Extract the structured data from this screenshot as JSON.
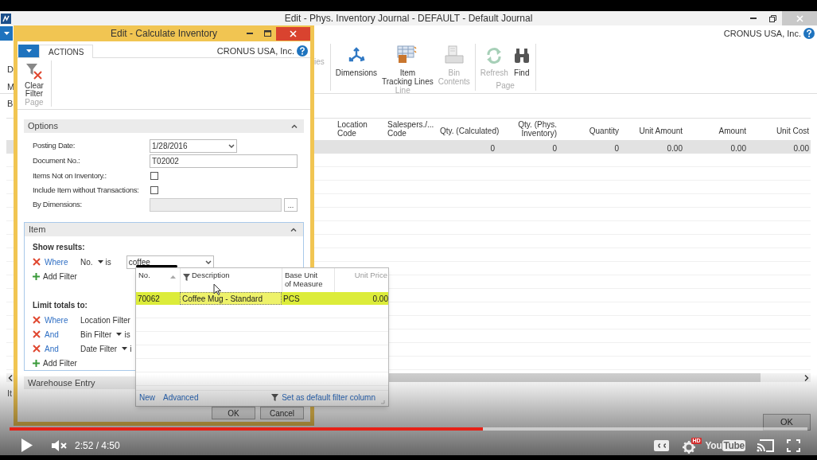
{
  "main_window": {
    "title": "Edit - Phys. Inventory Journal - DEFAULT - Default Journal",
    "company": "CRONUS USA, Inc.",
    "ribbon_fragments": [
      "D",
      "M"
    ],
    "ribbon_fragment_right": "ies",
    "ribbon_groups": [
      {
        "label": "Line",
        "actions": [
          {
            "label": "Dimensions",
            "disabled": false
          },
          {
            "label": "Item Tracking Lines",
            "disabled": false
          },
          {
            "label": "Bin Contents",
            "disabled": true
          }
        ]
      },
      {
        "label": "Page",
        "actions": [
          {
            "label": "Refresh",
            "disabled": true
          },
          {
            "label": "Find",
            "disabled": false
          }
        ]
      }
    ],
    "section_fragment": "B",
    "grid": {
      "columns": [
        "Location Code",
        "Salespers./... Code",
        "Qty. (Calculated)",
        "Qty. (Phys. Inventory)",
        "Quantity",
        "Unit Amount",
        "Amount",
        "Unit Cost"
      ],
      "rows": [
        {
          "selected": true,
          "cells": [
            "",
            "",
            "0",
            "0",
            "0",
            "0.00",
            "0.00",
            "0.00"
          ]
        }
      ]
    },
    "footer_fragment": "It",
    "buttons": [
      "OK"
    ]
  },
  "dialog": {
    "title": "Edit - Calculate Inventory",
    "tabs": [
      {
        "label": "ACTIONS",
        "selected": true
      }
    ],
    "company": "CRONUS USA, Inc.",
    "actions": [
      {
        "label": "Clear Filter"
      }
    ],
    "action_group": "Page",
    "options": {
      "title": "Options",
      "expanded": true,
      "fields": [
        {
          "label": "Posting Date:",
          "kind": "dropdown",
          "value": "1/28/2016"
        },
        {
          "label": "Document No.:",
          "kind": "text",
          "value": "T02002"
        },
        {
          "label": "Items Not on Inventory.:",
          "kind": "checkbox",
          "checked": false
        },
        {
          "label": "Include Item without Transactions:",
          "kind": "checkbox",
          "checked": false
        },
        {
          "label": "By Dimensions:",
          "kind": "lookup",
          "disabled": true,
          "button": "..."
        }
      ]
    },
    "item": {
      "title": "Item",
      "expanded": true,
      "show_results": {
        "heading": "Show results:",
        "filters": [
          {
            "conjunction": "Where",
            "field": "No.",
            "operator": "is",
            "value": "coffee"
          }
        ],
        "add": "Add Filter"
      },
      "limit_totals": {
        "heading": "Limit totals to:",
        "filters": [
          {
            "conjunction": "Where",
            "field": "Location Filter"
          },
          {
            "conjunction": "And",
            "field": "Bin Filter",
            "operator": "is"
          },
          {
            "conjunction": "And",
            "field": "Date Filter",
            "operator": "i"
          }
        ],
        "add": "Add Filter"
      }
    },
    "collapsed_section": "Warehouse Entry",
    "buttons": [
      "OK",
      "Cancel"
    ]
  },
  "lookup": {
    "columns": [
      {
        "label": "No.",
        "sorted": true,
        "filtered": false
      },
      {
        "label": "Description",
        "sorted": false,
        "filtered": true
      },
      {
        "label": "Base Unit of Measure",
        "sorted": false,
        "filtered": false
      },
      {
        "label": "Unit Price",
        "sorted": false,
        "filtered": false
      }
    ],
    "rows": [
      {
        "selected": true,
        "cells": [
          "70062",
          "Coffee Mug - Standard",
          "PCS",
          "0.00"
        ]
      }
    ],
    "links": [
      "New",
      "Advanced"
    ],
    "default_filter": "Set as default filter column"
  },
  "player": {
    "progress": {
      "level": 0.593
    },
    "time": "2:52 / 4:50",
    "hd_badge": "HD",
    "logo": [
      "You",
      "Tube"
    ]
  }
}
